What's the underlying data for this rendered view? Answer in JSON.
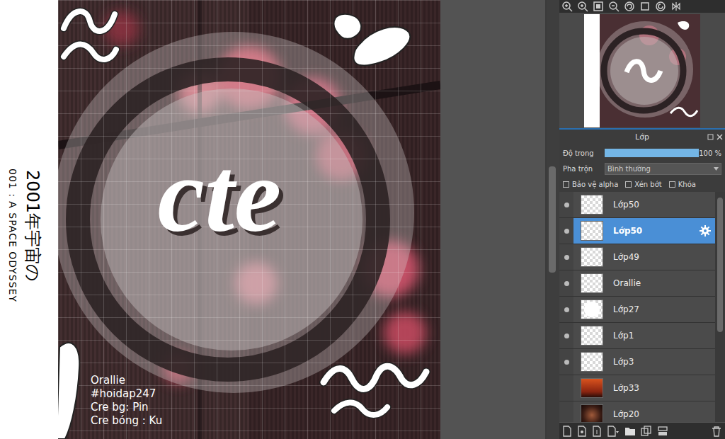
{
  "canvas": {
    "title": "cte",
    "credits": [
      "Orallie",
      "#hoidap247",
      "Cre bg: Pin",
      "Cre bóng : Ku"
    ],
    "side_title": "2001年宇宙の",
    "side_subtitle": "001 : A SPACE ODYSSEY"
  },
  "layers_panel": {
    "title": "Lớp",
    "opacity": {
      "label": "Độ trong",
      "level": 1,
      "reading": "100 %"
    },
    "blend": {
      "label": "Pha trộn",
      "value": "Bình thường"
    },
    "options": [
      {
        "label": "Bảo vệ alpha",
        "checked": false
      },
      {
        "label": "Xén bớt",
        "checked": false
      },
      {
        "label": "Khóa",
        "checked": false
      }
    ],
    "layers": [
      {
        "name": "Lớp50",
        "visible": true,
        "selected": false,
        "kind": "empty"
      },
      {
        "name": "Lớp50",
        "visible": true,
        "selected": true,
        "kind": "empty"
      },
      {
        "name": "Lớp49",
        "visible": true,
        "selected": false,
        "kind": "empty"
      },
      {
        "name": "Orallie",
        "visible": true,
        "selected": false,
        "kind": "empty"
      },
      {
        "name": "Lớp27",
        "visible": true,
        "selected": false,
        "kind": "circle"
      },
      {
        "name": "Lớp1",
        "visible": true,
        "selected": false,
        "kind": "empty"
      },
      {
        "name": "Lớp3",
        "visible": true,
        "selected": false,
        "kind": "empty"
      },
      {
        "name": "Lớp33",
        "visible": false,
        "selected": false,
        "kind": "sunset"
      },
      {
        "name": "Lớp20",
        "visible": false,
        "selected": false,
        "kind": "dark"
      }
    ]
  }
}
